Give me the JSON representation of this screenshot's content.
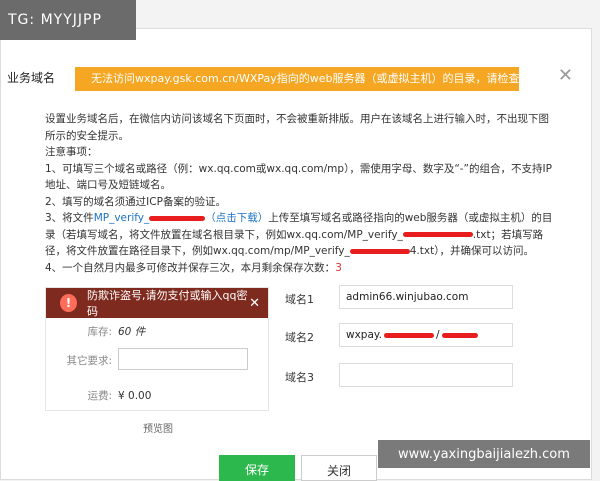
{
  "watermark_top": "TG: MYYJJPP",
  "watermark_bottom": "www.yaxingbaijialezh.com",
  "section_title": "业务域名",
  "warning_banner": "无法访问wxpay.gsk.com.cn/WXPay指向的web服务器（或虚拟主机）的目录，请检查网络设置",
  "description": {
    "intro": "设置业务域名后，在微信内访问该域名下页面时，不会被重新排版。用户在该域名上进行输入时，不出现下图所示的安全提示。",
    "notes_title": "注意事项：",
    "note1": "1、可填写三个域名或路径（例：wx.qq.com或wx.qq.com/mp），需使用字母、数字及“-”的组合，不支持IP地址、端口号及短链域名。",
    "note2": "2、填写的域名须通过ICP备案的验证。",
    "note3_prefix": "3、将文件",
    "note3_file": "MP_verify_",
    "note3_download": "（点击下载）",
    "note3_a": "上传至填写域名或路径指向的web服务器（或虚拟主机）的目录（若填写域名，将文件放置在域名根目录下，例如wx.qq.com/MP_verify_",
    "note3_b": ".txt；若填写路径，将文件放置在路径目录下，例如wx.qq.com/mp/MP_verify_",
    "note3_c": "4.txt），并确保可以访问。",
    "note4_prefix": "4、一个自然月内最多可修改并保存三次，本月剩余保存次数：",
    "note4_count": "3"
  },
  "preview": {
    "alert_text": "防欺诈盗号,请勿支付或输入qq密码",
    "alert_close": "✕",
    "stock_label": "库存:",
    "stock_value": "60 件",
    "other_label": "其它要求:",
    "shipping_label": "运费:",
    "shipping_value": "¥ 0.00",
    "caption": "预览图"
  },
  "domains": [
    {
      "label": "域名1",
      "value": "admin66.winjubao.com"
    },
    {
      "label": "域名2",
      "value": "wxpay."
    },
    {
      "label": "域名3",
      "value": ""
    }
  ],
  "buttons": {
    "save": "保存",
    "close": "关闭"
  },
  "colors": {
    "banner": "#f5a623",
    "save_button": "#2db84d",
    "link": "#1a73c7",
    "alert_bg": "#7e2a1e"
  }
}
